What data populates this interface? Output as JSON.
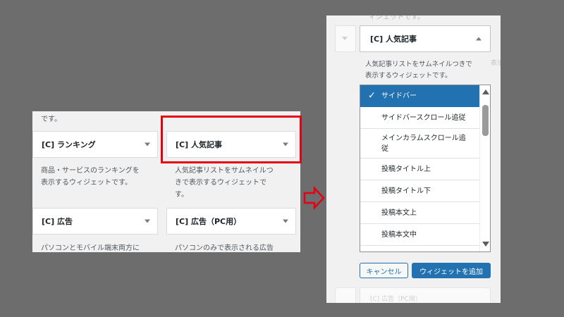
{
  "left": {
    "top_text": "です。",
    "widgets": [
      {
        "title": "[C] ランキング",
        "desc1": "商品・サービスのランキングを",
        "desc2": "表示するウィジェットです。"
      },
      {
        "title": "[C] 人気記事",
        "desc1": "人気記事リストをサムネイルつ",
        "desc2": "きで表示するウィジェットで",
        "desc3": "す。"
      },
      {
        "title": "[C] 広告",
        "desc1": "パソコンとモバイル端末両方に"
      },
      {
        "title": "[C] 広告（PC用）",
        "desc1": "パソコンのみで表示される広告"
      }
    ]
  },
  "right": {
    "cut_top": "ィジェットです。",
    "ghost_side": "表示",
    "widget_title": "[C] 人気記事",
    "desc_line1": "人気記事リストをサムネイルつきで",
    "desc_line2": "表示するウィジェットです。",
    "options": [
      {
        "label": "サイドバー",
        "selected": true
      },
      {
        "label": "サイドバースクロール追従"
      },
      {
        "label": "メインカラムスクロール追",
        "label2": "従"
      },
      {
        "label": "投稿タイトル上"
      },
      {
        "label": "投稿タイトル下"
      },
      {
        "label": "投稿本文上"
      },
      {
        "label": "投稿本文中"
      }
    ],
    "cancel_label": "キャンセル",
    "add_label": "ウィジェットを追加",
    "ghost_bottom": "[C] 広告（PC用）"
  },
  "colors": {
    "background": "#6d6d6d",
    "highlight": "#e50012",
    "accent": "#2271b1"
  },
  "icons": {
    "arrow": "right-arrow-outline-icon",
    "check": "checkmark-icon"
  }
}
